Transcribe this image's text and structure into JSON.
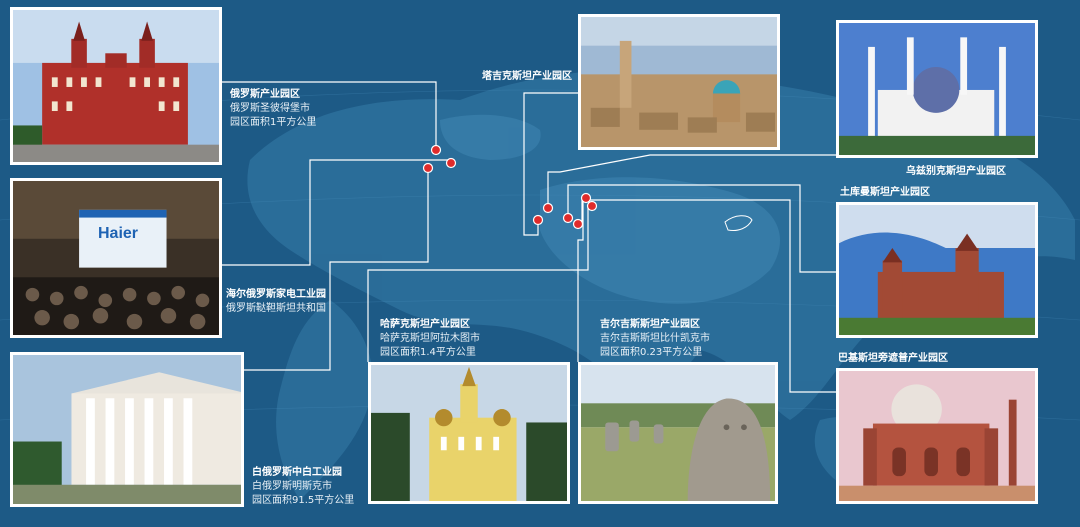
{
  "colors": {
    "ocean": "#1d5a86",
    "land": "#2c6f9b",
    "land_highlight": "#3f86b3",
    "marker": "#e02b2b",
    "connector": "#ffffff"
  },
  "hotspots": [
    {
      "kind": "marker-dot"
    },
    {
      "kind": "marker-dot"
    },
    {
      "kind": "marker-dot"
    },
    {
      "kind": "marker-dot"
    },
    {
      "kind": "marker-dot"
    },
    {
      "kind": "marker-dot"
    },
    {
      "kind": "marker-dot"
    },
    {
      "kind": "marker-dot"
    },
    {
      "kind": "marker-dot"
    },
    {
      "kind": "marker-dot"
    }
  ],
  "parks": [
    {
      "photo": "kremlin-museum-photo",
      "title": "俄罗斯产业园区",
      "lines": [
        "俄罗斯圣彼得堡市",
        "园区面积1平方公里"
      ]
    },
    {
      "photo": "haier-event-photo",
      "title": "海尔俄罗斯家电工业园",
      "lines": [
        "俄罗斯鞑靼斯坦共和国"
      ],
      "banner": "Haier"
    },
    {
      "photo": "white-columned-building-photo",
      "title": "白俄罗斯中白工业园",
      "lines": [
        "白俄罗斯明斯克市",
        "园区面积91.5平方公里"
      ]
    },
    {
      "photo": "ascension-cathedral-photo",
      "title": "哈萨克斯坦产业园区",
      "lines": [
        "哈萨克斯坦阿拉木图市",
        "园区面积1.4平方公里"
      ]
    },
    {
      "photo": "stone-statues-photo",
      "title": "吉尔吉斯斯坦产业园区",
      "lines": [
        "吉尔吉斯斯坦比什凯克市",
        "园区面积0.23平方公里"
      ]
    },
    {
      "photo": "khiva-old-town-photo",
      "title": "塔吉克斯坦产业园区",
      "lines": []
    },
    {
      "photo": "white-mosque-photo",
      "title": "乌兹别克斯坦产业园区",
      "lines": []
    },
    {
      "photo": "red-brick-castle-photo",
      "title": "土库曼斯坦产业园区",
      "lines": []
    },
    {
      "photo": "red-sandstone-mausoleum-photo",
      "title": "巴基斯坦旁遮普产业园区",
      "lines": []
    }
  ]
}
